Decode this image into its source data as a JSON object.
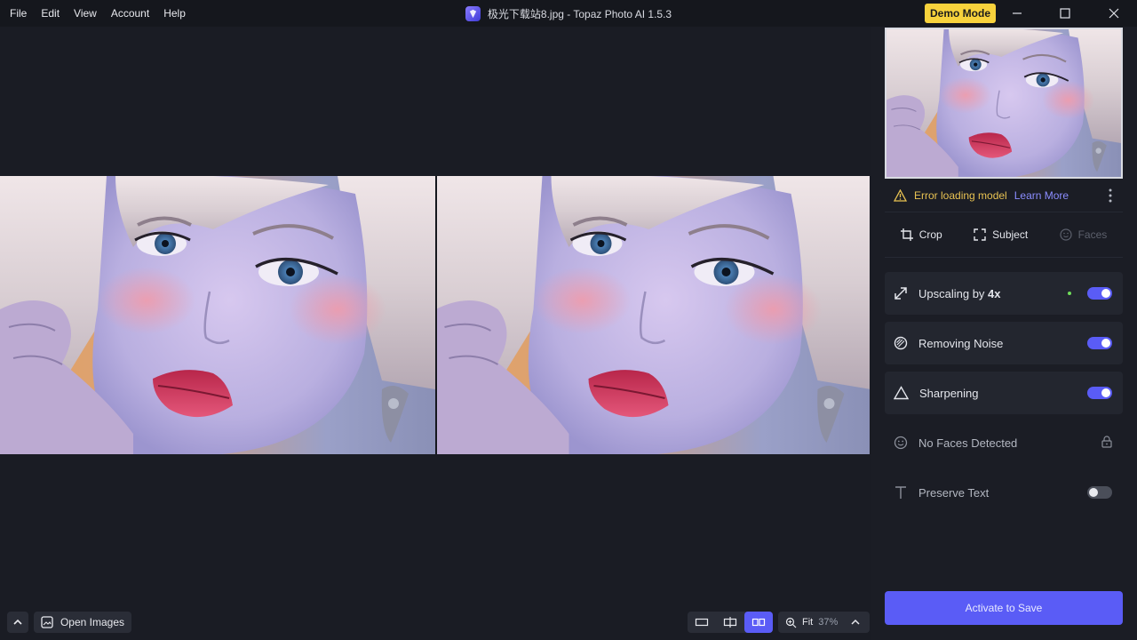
{
  "menu": {
    "items": [
      {
        "label": "File"
      },
      {
        "label": "Edit"
      },
      {
        "label": "View"
      },
      {
        "label": "Account"
      },
      {
        "label": "Help"
      }
    ]
  },
  "window": {
    "title": "极光下载站8.jpg - Topaz Photo AI 1.5.3",
    "demo_badge": "Demo Mode"
  },
  "panel": {
    "error": {
      "text": "Error loading model",
      "link": "Learn More"
    },
    "tools": [
      {
        "label": "Crop",
        "icon": "crop-icon",
        "enabled": true
      },
      {
        "label": "Subject",
        "icon": "subject-select-icon",
        "enabled": true
      },
      {
        "label": "Faces",
        "icon": "face-icon",
        "enabled": false
      }
    ],
    "features": {
      "upscaling": {
        "label": "Upscaling by ",
        "factor": "4x",
        "enabled": true
      },
      "noise": {
        "label": "Removing Noise",
        "enabled": true
      },
      "sharpen": {
        "label": "Sharpening",
        "enabled": true
      },
      "faces": {
        "label": "No Faces Detected",
        "locked": true
      },
      "text": {
        "label": "Preserve Text",
        "enabled": false
      }
    },
    "save_label": "Activate to Save"
  },
  "bottom": {
    "open_images": "Open Images",
    "zoom_label": "Fit",
    "zoom_pct": "37%"
  },
  "colors": {
    "accent": "#5a5cf6",
    "warning": "#e8c252",
    "demo": "#f7d23c"
  }
}
